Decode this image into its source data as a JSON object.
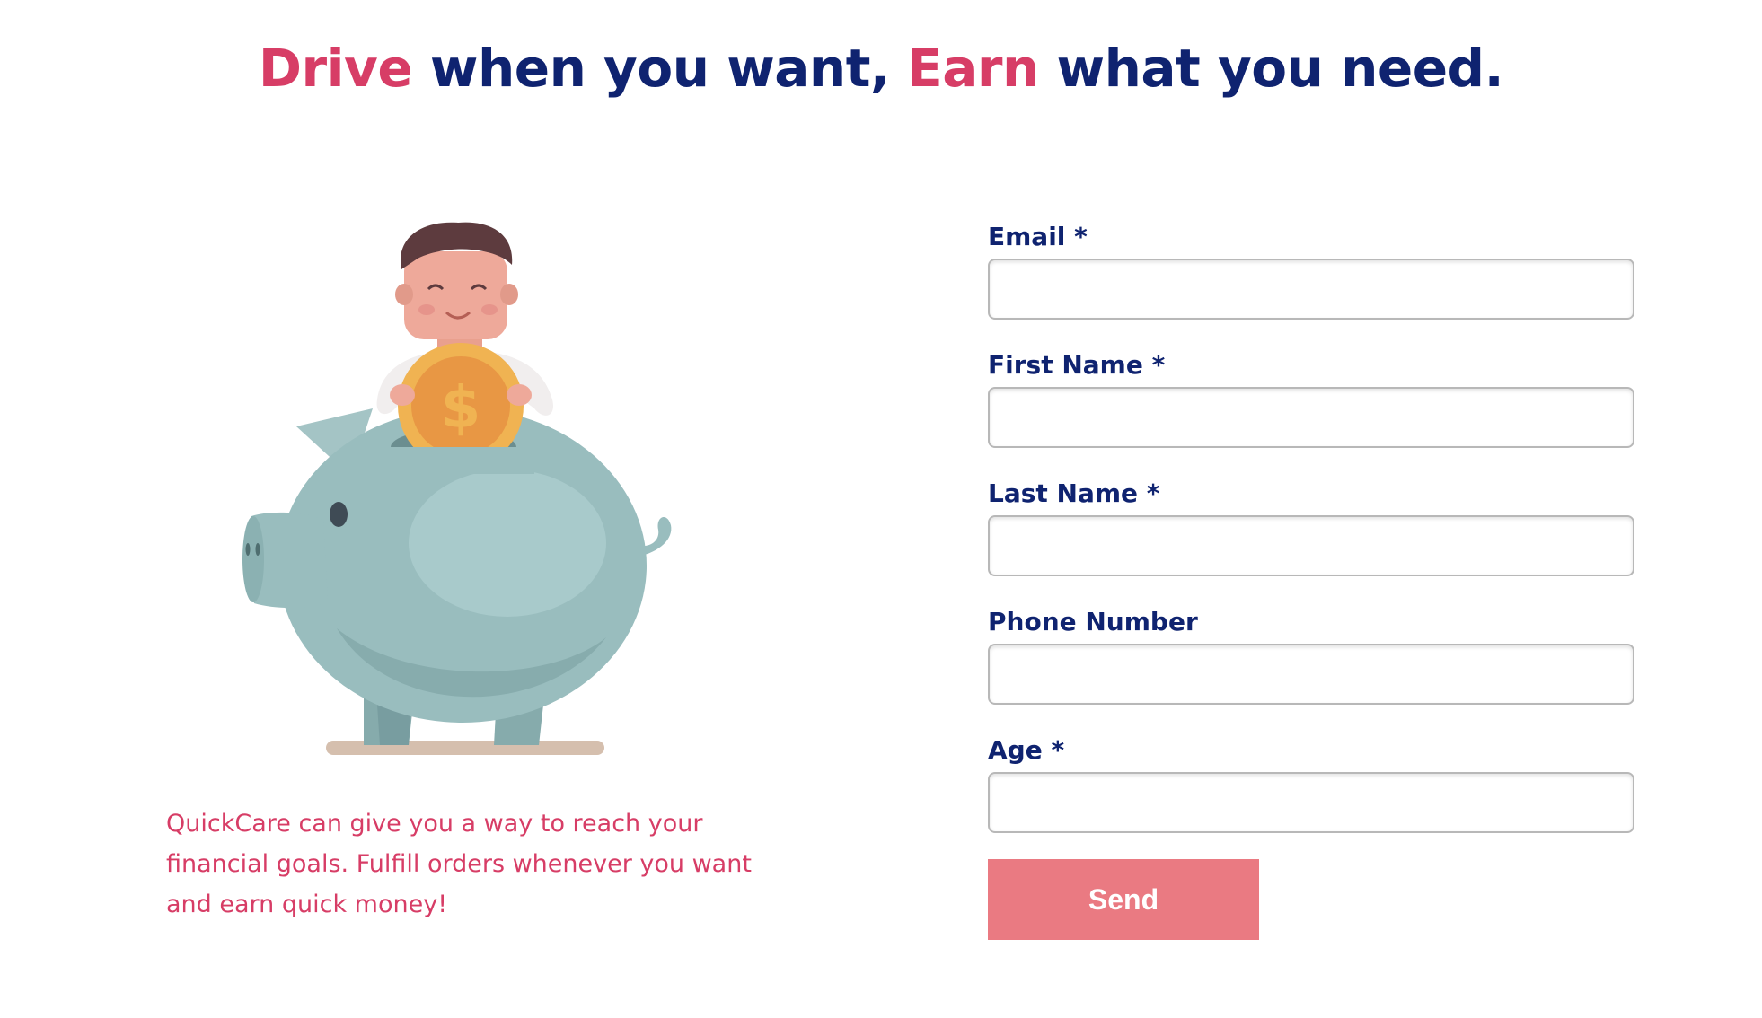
{
  "headline": {
    "word1": "Drive",
    "part2": " when you want, ",
    "word3": "Earn",
    "part4": " what you need."
  },
  "blurb": {
    "text": "QuickCare can give you a way to reach your financial goals. Fulfill orders whenever you want and earn quick money!"
  },
  "form": {
    "fields": [
      {
        "label": "Email *",
        "value": ""
      },
      {
        "label": "First Name *",
        "value": ""
      },
      {
        "label": "Last Name *",
        "value": ""
      },
      {
        "label": "Phone Number",
        "value": ""
      },
      {
        "label": "Age *",
        "value": ""
      }
    ],
    "submit_label": "Send"
  },
  "illustration": {
    "icon": "piggy-bank-coin-illustration",
    "coin_symbol": "$"
  },
  "colors": {
    "navy": "#0f2370",
    "accent_pink": "#d73d66",
    "button": "#ea7a82"
  }
}
